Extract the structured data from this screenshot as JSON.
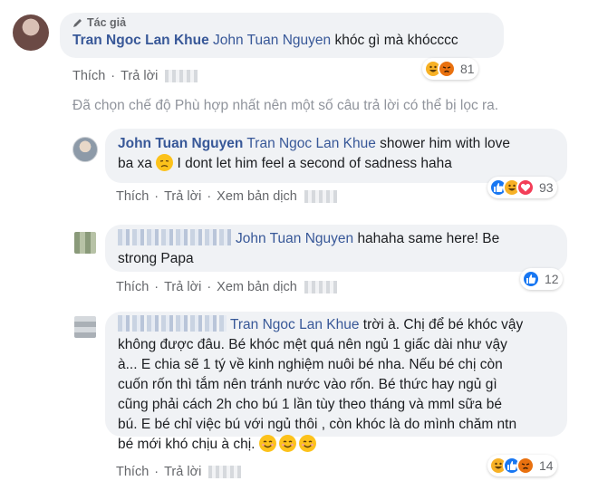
{
  "main_comment": {
    "author_badge": "Tác giả",
    "author": "Tran Ngoc Lan Khue",
    "mention": "John Tuan Nguyen",
    "text": "khóc gì mà khócccc",
    "actions": {
      "like": "Thích",
      "reply": "Trả lời"
    },
    "reaction_count": "81",
    "reactions": [
      "haha",
      "angry"
    ]
  },
  "filter_notice": "Đã chọn chế độ Phù hợp nhất nên một số câu trả lời có thể bị lọc ra.",
  "replies": [
    {
      "author": "John Tuan Nguyen",
      "mention": "Tran Ngoc Lan Khue",
      "text_line1": "shower him with love",
      "text_line2": "ba xa",
      "text_line2_rest": "I dont let him feel a second of sadness haha",
      "actions": {
        "like": "Thích",
        "reply": "Trả lời",
        "translate": "Xem bản dịch"
      },
      "reaction_count": "93",
      "reactions": [
        "like",
        "haha",
        "love"
      ]
    },
    {
      "mention": "John Tuan Nguyen",
      "text_line1": "hahaha same here! Be",
      "text_line2": "strong Papa",
      "actions": {
        "like": "Thích",
        "reply": "Trả lời",
        "translate": "Xem bản dịch"
      },
      "reaction_count": "12",
      "reactions": [
        "like"
      ]
    },
    {
      "mention": "Tran Ngoc Lan Khue",
      "text_line1": "trời à. Chị để bé khóc vậy",
      "lines": [
        "không được đâu. Bé khóc mệt quá nên ngủ 1 giấc dài như vậy",
        "à... E chia sẽ 1 tý về kinh nghiệm nuôi bé nha. Nếu bé chị còn",
        "cuốn rốn thì tắm nên tránh nước vào rốn. Bé thức hay ngủ gì",
        "cũng phải cách 2h cho bú 1 lần tùy theo tháng và mml sữa bé",
        "bú. E bé chỉ việc bú với ngủ thôi , còn khóc là do mình chăm ntn",
        "bé mới khó chịu à chị."
      ],
      "actions": {
        "like": "Thích",
        "reply": "Trả lời"
      },
      "reaction_count": "14",
      "reactions": [
        "haha",
        "like",
        "angry"
      ]
    }
  ],
  "colors": {
    "link": "#385898",
    "meta": "#65676b",
    "bubble": "#f0f2f5"
  }
}
